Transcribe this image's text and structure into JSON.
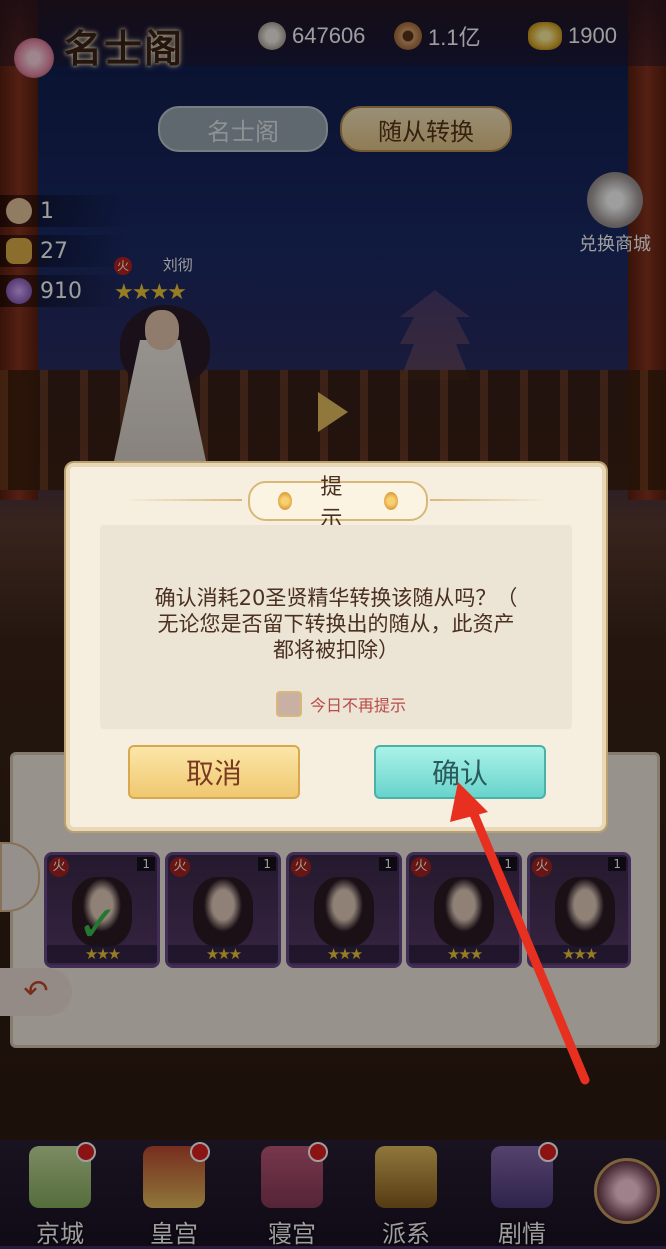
{
  "header": {
    "title": "名士阁",
    "resources": [
      {
        "icon": "silver-coin-icon",
        "value": "647606"
      },
      {
        "icon": "copper-coin-icon",
        "value": "1.1亿"
      },
      {
        "icon": "gold-ingot-icon",
        "value": "1900"
      }
    ]
  },
  "tabs": [
    {
      "label": "名士阁",
      "active": false
    },
    {
      "label": "随从转换",
      "active": true
    }
  ],
  "shop": {
    "label": "兑换商城"
  },
  "counters": [
    {
      "icon": "essence-icon",
      "value": "1"
    },
    {
      "icon": "gold-leaf-icon",
      "value": "27"
    },
    {
      "icon": "purple-orb-icon",
      "value": "910"
    }
  ],
  "hero": {
    "element": "火",
    "name": "刘彻",
    "stars": "★★★★"
  },
  "slots": [
    {
      "element": "火",
      "level": "1",
      "stars": "★★★",
      "selected": true
    },
    {
      "element": "火",
      "level": "1",
      "stars": "★★★",
      "selected": false
    },
    {
      "element": "火",
      "level": "1",
      "stars": "★★★",
      "selected": false
    },
    {
      "element": "火",
      "level": "1",
      "stars": "★★★",
      "selected": false
    },
    {
      "element": "火",
      "level": "1",
      "stars": "★★★",
      "selected": false
    }
  ],
  "modal": {
    "title": "提示",
    "message_line1": "确认消耗20圣贤精华转换该随从吗？（",
    "message_line2": "无论您是否留下转换出的随从，此资产",
    "message_line3": "都将被扣除）",
    "checkbox_label": "今日不再提示",
    "cancel_label": "取消",
    "confirm_label": "确认"
  },
  "nav": [
    {
      "label": "京城",
      "icon": "map-icon",
      "badge": true
    },
    {
      "label": "皇宫",
      "icon": "palace-icon",
      "badge": true
    },
    {
      "label": "寝宫",
      "icon": "bedchamber-icon",
      "badge": true
    },
    {
      "label": "派系",
      "icon": "faction-icon",
      "badge": false
    },
    {
      "label": "剧情",
      "icon": "story-icon",
      "badge": true
    }
  ],
  "colors": {
    "accent_arrow": "#e83020",
    "confirm": "#68d4cc",
    "cancel": "#f0c870"
  }
}
